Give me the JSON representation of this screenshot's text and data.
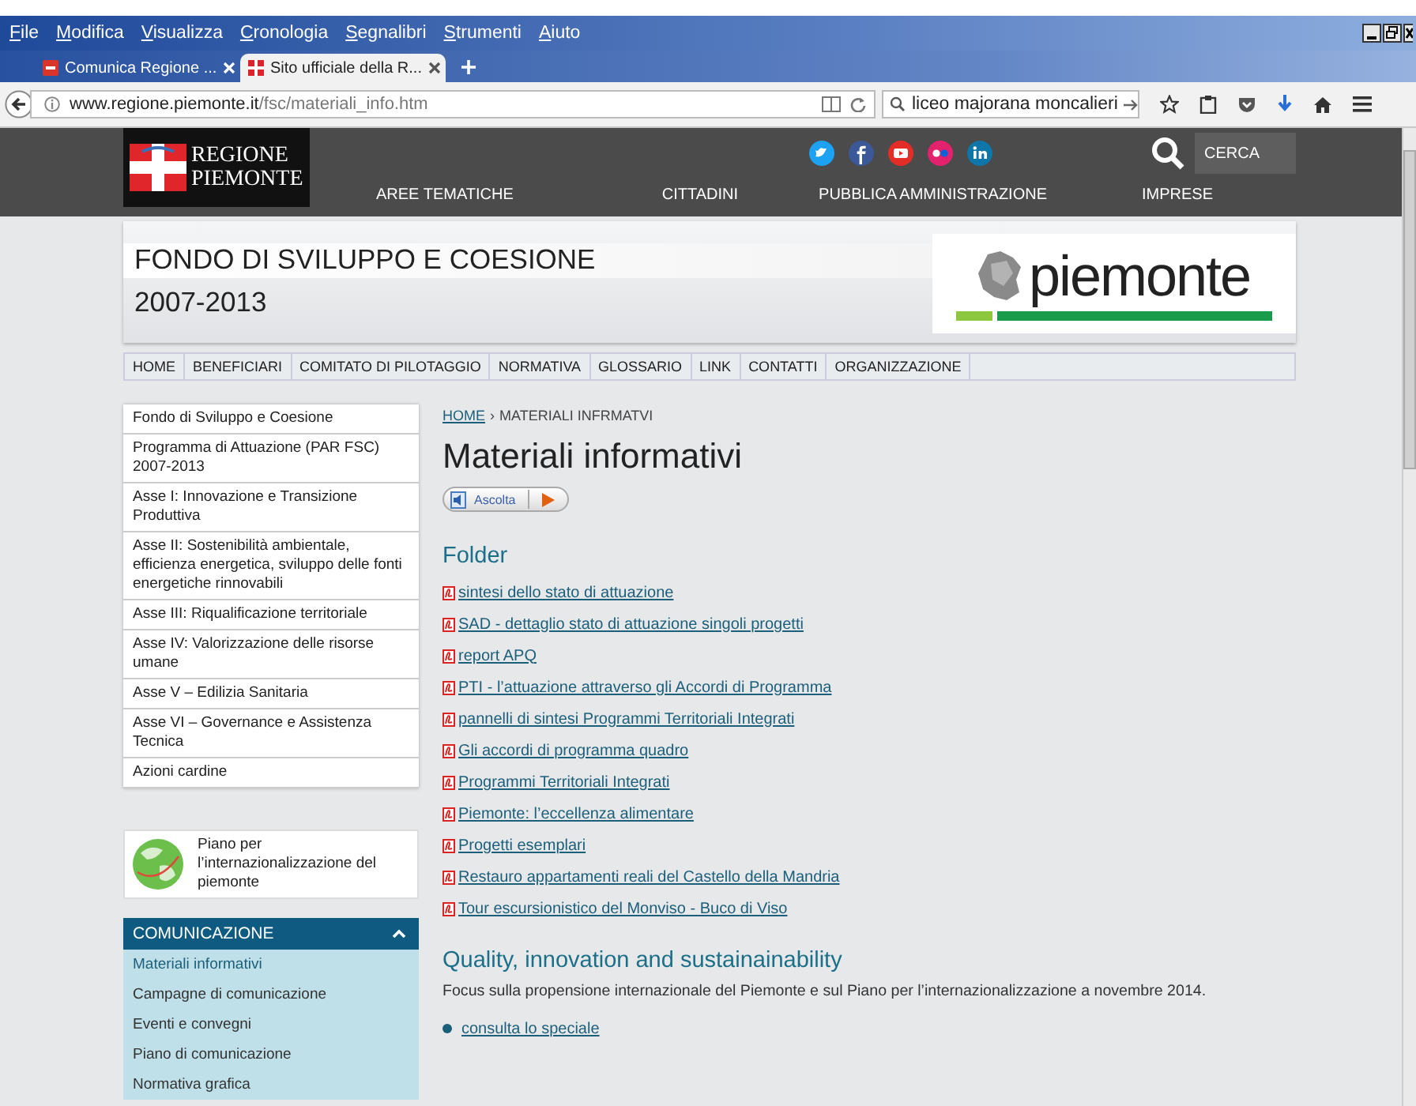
{
  "window": {
    "menu": [
      "File",
      "Modifica",
      "Visualizza",
      "Cronologia",
      "Segnalibri",
      "Strumenti",
      "Aiuto"
    ]
  },
  "tabs": [
    {
      "label": "Comunica Regione ...",
      "selected": false
    },
    {
      "label": "Sito ufficiale della R...",
      "selected": true
    }
  ],
  "address_bar": {
    "host": "www.regione.piemonte.it",
    "path": "/fsc/materiali_info.htm"
  },
  "browser_search": {
    "value": "liceo majorana moncalieri"
  },
  "site_header": {
    "logo_lines": [
      "REGIONE",
      "PIEMONTE"
    ],
    "nav": [
      "AREE TEMATICHE",
      "CITTADINI",
      "PUBBLICA AMMINISTRAZIONE",
      "IMPRESE"
    ],
    "search_label": "CERCA"
  },
  "banner": {
    "title": "FONDO DI SVILUPPO E COESIONE",
    "subtitle": "2007-2013",
    "logo_text": "piemonte"
  },
  "subnav": [
    "HOME",
    "BENEFICIARI",
    "COMITATO DI PILOTAGGIO",
    "NORMATIVA",
    "GLOSSARIO",
    "LINK",
    "CONTATTI",
    "ORGANIZZAZIONE"
  ],
  "sidebar": {
    "menu": [
      "Fondo di Sviluppo e Coesione",
      "Programma di Attuazione (PAR FSC) 2007-2013",
      "Asse I: Innovazione e Transizione Produttiva",
      "Asse II: Sostenibilità ambientale, efficienza energetica, sviluppo delle fonti energetiche rinnovabili",
      "Asse III: Riqualificazione territoriale",
      "Asse IV: Valorizzazione delle risorse umane",
      "Asse V – Edilizia Sanitaria",
      "Asse VI – Governance e Assistenza Tecnica",
      "Azioni cardine"
    ],
    "promo": "Piano per l’internazionalizzazione del piemonte",
    "panel": {
      "title": "COMUNICAZIONE",
      "expanded": true,
      "items": [
        {
          "label": "Materiali informativi",
          "selected": true
        },
        {
          "label": "Campagne di comunicazione",
          "selected": false
        },
        {
          "label": "Eventi e convegni",
          "selected": false
        },
        {
          "label": "Piano di comunicazione",
          "selected": false
        },
        {
          "label": "Normativa grafica",
          "selected": false
        }
      ]
    }
  },
  "content": {
    "breadcrumb": {
      "home": "HOME",
      "separator": "›",
      "current": "MATERIALI INFRMATVI"
    },
    "title": "Materiali informativi",
    "listen_button": "Ascolta",
    "folder": {
      "heading": "Folder",
      "links": [
        "sintesi dello stato di attuazione",
        "SAD - dettaglio stato di attuazione singoli progetti",
        "report APQ",
        "PTI - l’attuazione attraverso gli Accordi di Programma",
        "pannelli di sintesi Programmi Territoriali Integrati",
        "Gli accordi di programma quadro",
        "Programmi Territoriali Integrati",
        "Piemonte: l’eccellenza alimentare",
        "Progetti esemplari",
        "Restauro appartamenti reali del Castello della Mandria",
        "Tour escursionistico del Monviso - Buco di Viso"
      ]
    },
    "quality": {
      "heading": "Quality, innovation and sustainainability",
      "text": "Focus sulla propensione internazionale del Piemonte e sul Piano per l’internazionalizzazione a novembre 2014.",
      "link": "consulta lo speciale"
    }
  }
}
